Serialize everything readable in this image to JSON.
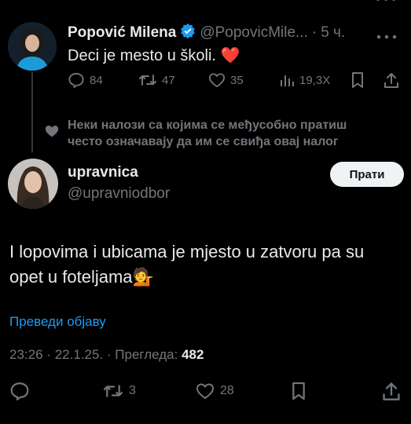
{
  "quoted_tweet": {
    "author_name": "Popović Milena",
    "handle": "@PopovicMile...",
    "separator": "·",
    "time": "5 ч.",
    "text": "Deci je mesto u školi. ❤️",
    "stats": {
      "replies": "84",
      "reposts": "47",
      "likes": "35",
      "views": "19,3X"
    }
  },
  "social_context": {
    "line1": "Неки налози са којима се међусобно пратиш",
    "line2": "често означавају да им се свиђа овај налог"
  },
  "main_tweet": {
    "author_name": "upravnica",
    "handle": "@upravniodbor",
    "follow_label": "Прати",
    "text_line1": "I lopovima i ubicama je mjesto u zatvoru pa su",
    "text_line2": "opet u foteljama💁",
    "translate_label": "Преведи објаву",
    "time": "23:26",
    "date": "22.1.25.",
    "views_label": "Прегледа:",
    "views_count": "482",
    "sep": "·",
    "actions": {
      "reposts": "3",
      "likes": "28"
    }
  },
  "colors": {
    "background": "#000000",
    "link": "#1d9bf0",
    "muted": "#71767b",
    "heart": "#f91880",
    "verified": "#1d9bf0"
  }
}
